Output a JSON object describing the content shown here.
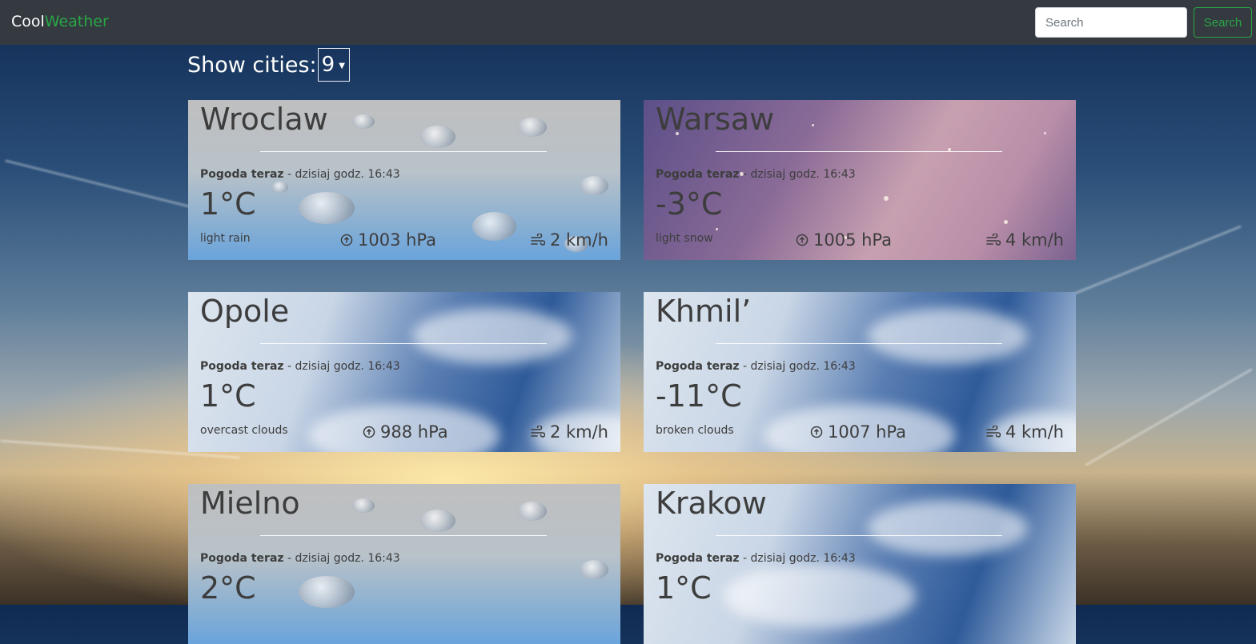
{
  "app": {
    "brand_part1": "Cool",
    "brand_part2": "Weather"
  },
  "search": {
    "placeholder": "Search",
    "button_label": "Search"
  },
  "controls": {
    "show_label": "Show cities:",
    "selected_count": "9"
  },
  "cards": [
    {
      "city": "Wroclaw",
      "now_label": "Pogoda teraz",
      "time": " - dzisiaj godz. 16:43",
      "temp": "1°C",
      "desc": "light rain",
      "pressure": "1003 hPa",
      "wind": "2 km/h"
    },
    {
      "city": "Warsaw",
      "now_label": "Pogoda teraz",
      "time": " - dzisiaj godz. 16:43",
      "temp": "-3°C",
      "desc": "light snow",
      "pressure": "1005 hPa",
      "wind": "4 km/h"
    },
    {
      "city": "Opole",
      "now_label": "Pogoda teraz",
      "time": " - dzisiaj godz. 16:43",
      "temp": "1°C",
      "desc": "overcast clouds",
      "pressure": "988 hPa",
      "wind": "2 km/h"
    },
    {
      "city": "Khmil’",
      "now_label": "Pogoda teraz",
      "time": " - dzisiaj godz. 16:43",
      "temp": "-11°C",
      "desc": "broken clouds",
      "pressure": "1007 hPa",
      "wind": "4 km/h"
    },
    {
      "city": "Mielno",
      "now_label": "Pogoda teraz",
      "time": " - dzisiaj godz. 16:43",
      "temp": "2°C",
      "desc": "",
      "pressure": "",
      "wind": ""
    },
    {
      "city": "Krakow",
      "now_label": "Pogoda teraz",
      "time": " - dzisiaj godz. 16:43",
      "temp": "1°C",
      "desc": "",
      "pressure": "",
      "wind": ""
    }
  ],
  "icons": {
    "pressure": "arrow-up-circle-icon",
    "wind": "wind-icon"
  },
  "colors": {
    "navbar": "#343a40",
    "accent": "#28a745",
    "text_dark": "#3d3d3d"
  }
}
